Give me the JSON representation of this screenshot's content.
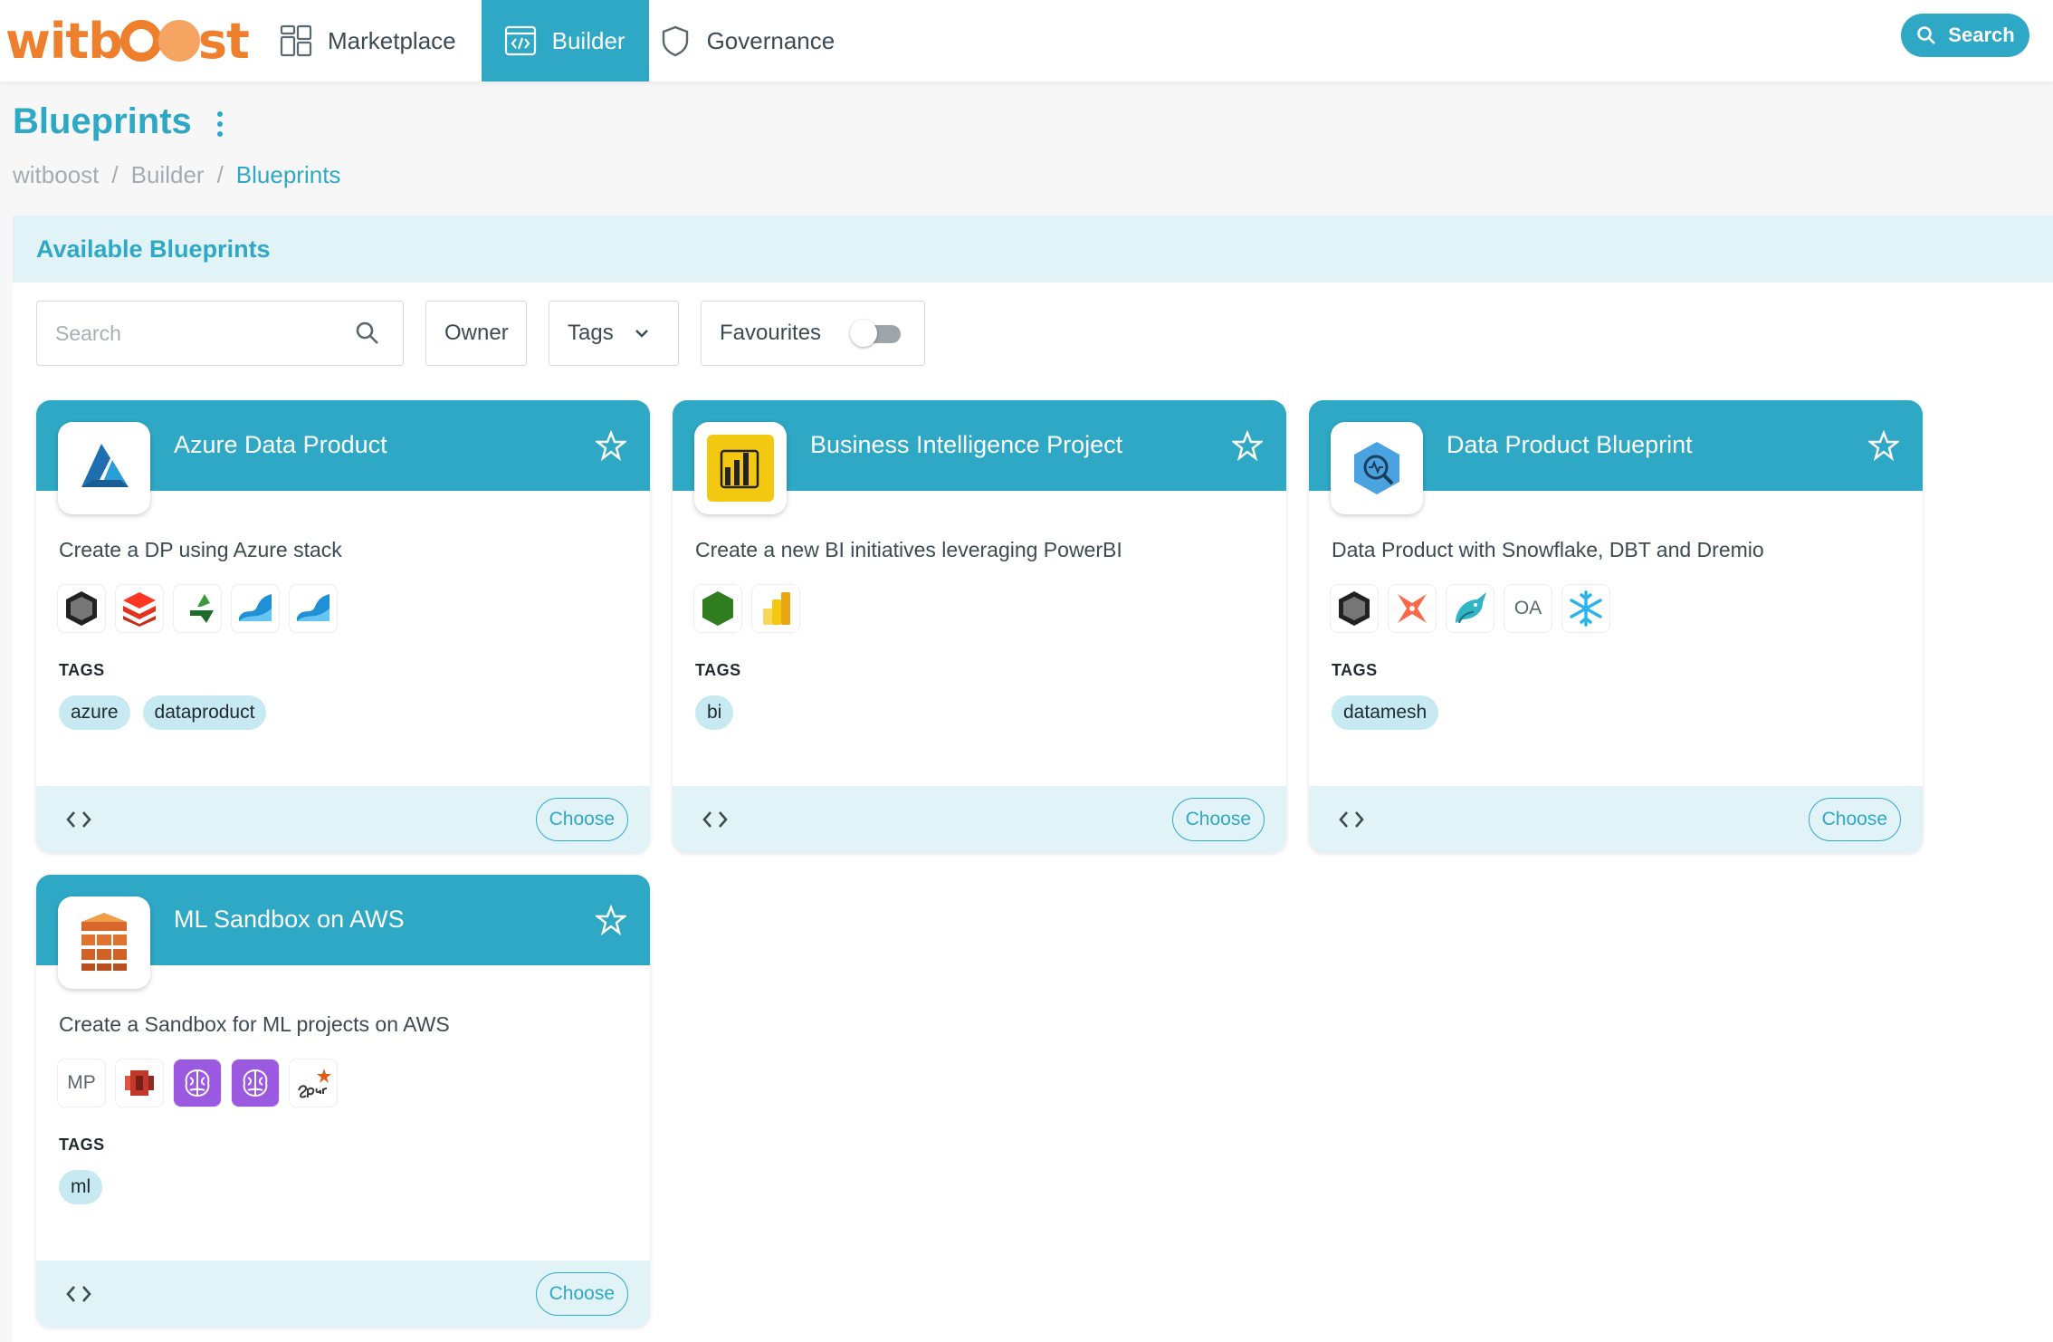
{
  "app": {
    "logo_text": "witboost"
  },
  "nav": {
    "items": [
      {
        "label": "Marketplace",
        "icon": "grid-icon"
      },
      {
        "label": "Builder",
        "icon": "code-window-icon",
        "active": true
      },
      {
        "label": "Governance",
        "icon": "shield-icon"
      }
    ],
    "search_label": "Search"
  },
  "page": {
    "title": "Blueprints",
    "breadcrumb": [
      "witboost",
      "Builder",
      "Blueprints"
    ]
  },
  "panel": {
    "title": "Available Blueprints",
    "filters": {
      "search_placeholder": "Search",
      "owner_label": "Owner",
      "tags_label": "Tags",
      "favourites_label": "Favourites",
      "favourites_on": false
    }
  },
  "cards": [
    {
      "title": "Azure Data Product",
      "logo": "azure-logo-icon",
      "description": "Create a DP using Azure stack",
      "tech_icons": [
        "hexagon-icon",
        "databricks-icon",
        "data-factory-icon",
        "synapse-icon",
        "synapse-icon"
      ],
      "tags_label": "TAGS",
      "tags": [
        "azure",
        "dataproduct"
      ],
      "choose_label": "Choose"
    },
    {
      "title": "Business Intelligence Project",
      "logo": "powerbi-logo-icon",
      "description": "Create a new BI initiatives leveraging PowerBI",
      "tech_icons": [
        "green-hexagon-icon",
        "powerbi-icon"
      ],
      "tags_label": "TAGS",
      "tags": [
        "bi"
      ],
      "choose_label": "Choose"
    },
    {
      "title": "Data Product Blueprint",
      "logo": "data-search-logo-icon",
      "description": "Data Product with Snowflake, DBT and Dremio",
      "tech_icons": [
        "hexagon-icon",
        "dbt-icon",
        "dremio-icon",
        "OA",
        "snowflake-icon"
      ],
      "tags_label": "TAGS",
      "tags": [
        "datamesh"
      ],
      "choose_label": "Choose"
    },
    {
      "title": "ML Sandbox on AWS",
      "logo": "aws-logo-icon",
      "description": "Create a Sandbox for ML projects on AWS",
      "tech_icons": [
        "MP",
        "s3-icon",
        "brain-icon",
        "brain-icon",
        "spark-icon"
      ],
      "tags_label": "TAGS",
      "tags": [
        "ml"
      ],
      "choose_label": "Choose"
    }
  ],
  "colors": {
    "accent": "#2ea8c4",
    "logo_orange": "#ee7f2d",
    "band_light": "#e2f3f7",
    "chip": "#c7e9f1"
  }
}
